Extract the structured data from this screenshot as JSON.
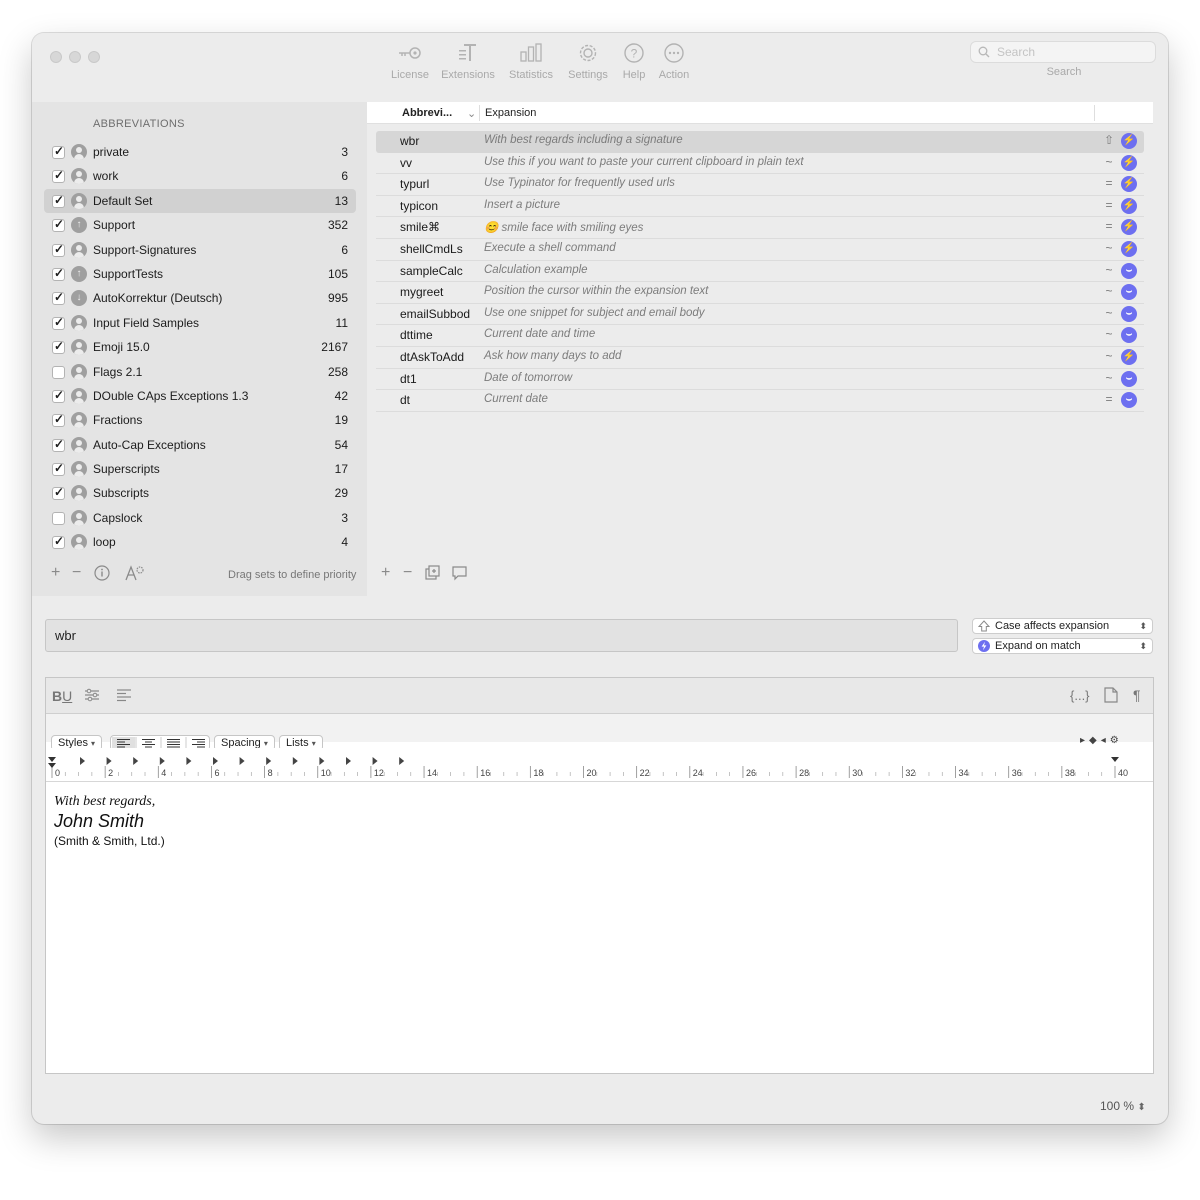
{
  "toolbar": {
    "items": [
      {
        "label": "License",
        "icon": "key-icon"
      },
      {
        "label": "Extensions",
        "icon": "extensions-icon"
      },
      {
        "label": "Statistics",
        "icon": "statistics-icon"
      },
      {
        "label": "Settings",
        "icon": "gear-icon"
      },
      {
        "label": "Help",
        "icon": "help-icon"
      },
      {
        "label": "Action",
        "icon": "action-icon"
      }
    ],
    "search_placeholder": "Search",
    "search_label": "Search"
  },
  "sidebar": {
    "header": "ABBREVIATIONS",
    "sets": [
      {
        "name": "private",
        "count": "3",
        "checked": true,
        "icon": "person-icon"
      },
      {
        "name": "work",
        "count": "6",
        "checked": true,
        "icon": "person-icon"
      },
      {
        "name": "Default Set",
        "count": "13",
        "checked": true,
        "icon": "person-icon",
        "selected": true
      },
      {
        "name": "Support",
        "count": "352",
        "checked": true,
        "icon": "upload-icon"
      },
      {
        "name": "Support-Signatures",
        "count": "6",
        "checked": true,
        "icon": "person-icon"
      },
      {
        "name": "SupportTests",
        "count": "105",
        "checked": true,
        "icon": "upload-icon"
      },
      {
        "name": "AutoKorrektur (Deutsch)",
        "count": "995",
        "checked": true,
        "icon": "download-icon"
      },
      {
        "name": "Input Field Samples",
        "count": "11",
        "checked": true,
        "icon": "person-icon"
      },
      {
        "name": "Emoji 15.0",
        "count": "2167",
        "checked": true,
        "icon": "person-icon"
      },
      {
        "name": "Flags 2.1",
        "count": "258",
        "checked": false,
        "icon": "person-icon"
      },
      {
        "name": "DOuble CAps Exceptions 1.3",
        "count": "42",
        "checked": true,
        "icon": "person-icon"
      },
      {
        "name": "Fractions",
        "count": "19",
        "checked": true,
        "icon": "person-icon"
      },
      {
        "name": "Auto-Cap Exceptions",
        "count": "54",
        "checked": true,
        "icon": "person-icon"
      },
      {
        "name": "Superscripts",
        "count": "17",
        "checked": true,
        "icon": "person-icon"
      },
      {
        "name": "Subscripts",
        "count": "29",
        "checked": true,
        "icon": "person-icon"
      },
      {
        "name": "Capslock",
        "count": "3",
        "checked": false,
        "icon": "person-icon"
      },
      {
        "name": "loop",
        "count": "4",
        "checked": true,
        "icon": "person-icon"
      }
    ],
    "drag_hint": "Drag sets to define priority"
  },
  "table": {
    "col_abbr": "Abbrevi...",
    "col_expansion": "Expansion",
    "rows": [
      {
        "abbr": "wbr",
        "expansion": "With best regards including a signature",
        "mode": "⇧",
        "badge": "lightning",
        "selected": true
      },
      {
        "abbr": "vv",
        "expansion": "Use this if you want to paste your current clipboard in plain text",
        "mode": "~",
        "badge": "lightning"
      },
      {
        "abbr": "typurl",
        "expansion": "Use Typinator for frequently used urls",
        "mode": "=",
        "badge": "lightning"
      },
      {
        "abbr": "typicon",
        "expansion": "Insert a picture",
        "mode": "=",
        "badge": "lightning"
      },
      {
        "abbr": "smile⌘",
        "expansion": "😊 smile face with smiling eyes",
        "mode": "=",
        "badge": "lightning"
      },
      {
        "abbr": "shellCmdLs",
        "expansion": "Execute a shell command",
        "mode": "~",
        "badge": "lightning"
      },
      {
        "abbr": "sampleCalc",
        "expansion": "Calculation example",
        "mode": "~",
        "badge": "space"
      },
      {
        "abbr": "mygreet",
        "expansion": "Position the cursor within the expansion text",
        "mode": "~",
        "badge": "space"
      },
      {
        "abbr": "emailSubbod",
        "expansion": "Use one snippet for subject and email body",
        "mode": "~",
        "badge": "space"
      },
      {
        "abbr": "dttime",
        "expansion": "Current date and time",
        "mode": "~",
        "badge": "space"
      },
      {
        "abbr": "dtAskToAdd",
        "expansion": "Ask how many days to add",
        "mode": "~",
        "badge": "lightning"
      },
      {
        "abbr": "dt1",
        "expansion": "Date of tomorrow",
        "mode": "~",
        "badge": "space"
      },
      {
        "abbr": "dt",
        "expansion": "Current date",
        "mode": "=",
        "badge": "space"
      }
    ]
  },
  "editor": {
    "abbreviation_value": "wbr",
    "case_option": "Case affects expansion",
    "expand_option": "Expand on match",
    "toolbar_right": [
      "{...}",
      "¶"
    ],
    "format_styles": "Styles",
    "format_spacing": "Spacing",
    "format_lists": "Lists",
    "ruler_labels": [
      "0",
      "2",
      "4",
      "6",
      "8",
      "10",
      "12",
      "14",
      "16",
      "18",
      "20",
      "22",
      "24",
      "26",
      "28",
      "30",
      "32",
      "34",
      "36",
      "38",
      "40"
    ],
    "content": {
      "line1": "With best regards,",
      "line2": "John  Smith",
      "line3": "(Smith & Smith, Ltd.)"
    }
  },
  "zoom": "100 %",
  "colors": {
    "badge_accent": "#6d6ff0",
    "selection": "#d6d6d6",
    "sidebar_bg": "#e4e4e4"
  }
}
